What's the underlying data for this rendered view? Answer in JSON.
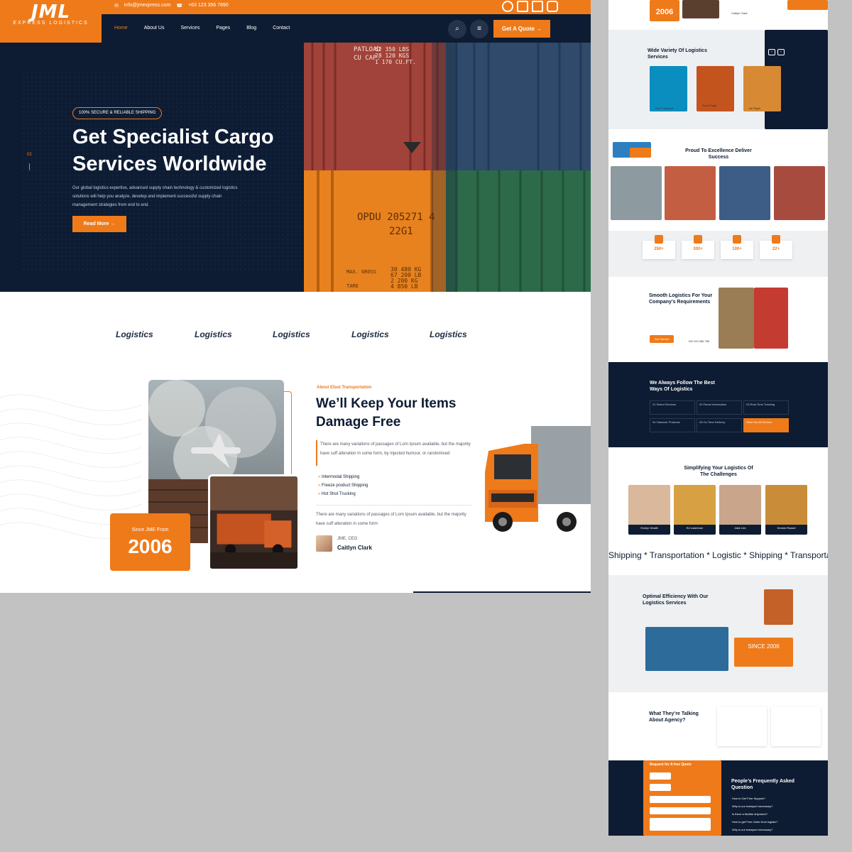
{
  "brand": {
    "logo_mark": "JML",
    "logo_sub": "EXPRESS LOGISTICS"
  },
  "topbar": {
    "email": "info@jmexpress.com",
    "phone": "+63 123 356 7890"
  },
  "nav": {
    "items": [
      "Home",
      "About Us",
      "Services",
      "Pages",
      "Blog",
      "Contact"
    ],
    "search_icon": "⌕",
    "menu_icon": "≡",
    "cta": "Get A Quote →"
  },
  "hero": {
    "badge": "100% SECURE & RELIABLE SHIPPING",
    "title": "Get Specialist Cargo Services Worldwide",
    "text": "Our global logistics expertise, advanced supply chain technology & customized logistics solutions will help you analyze, develop and implement successful supply chain management strategies from end to end.",
    "button": "Read More →",
    "slide": "02",
    "container_codes": [
      "PATLOAD",
      "CU CAP.",
      "62 350 LBS",
      "28 120 KGS",
      "1 170 CU.FT.",
      "OPDU 205271 4",
      "22G1",
      "MAX. GROSS",
      "TARE",
      "30 480 KG",
      "67 200 LB",
      "2 200 KG",
      "4 850 LB"
    ]
  },
  "brands": [
    "Logistics",
    "Logistics",
    "Logistics",
    "Logistics",
    "Logistics"
  ],
  "about": {
    "eyebrow": "About Efast Transportation",
    "title": "We’ll Keep Your Items Damage Free",
    "quote": "There are many variations of passages of Lorn Ipsum available, but the majority have suff alteration in some form, by injected humour, or randomised",
    "list": [
      "Intermodal Shipping",
      "Freeze product Shipping",
      "Hot Shot Trucking"
    ],
    "text2": "There are many variations of passages of Lorn Ipsum available, but the majority have suff alteration in some form",
    "ceo_role": "JME, CEO",
    "ceo_name": "Caitlyn Clark",
    "since_label": "Since JME From",
    "since_year": "2006"
  },
  "side": {
    "top_year": "2006",
    "top_name": "Caitlyn Clark",
    "variety_title": "Wide Variety Of Logistics Services",
    "services": [
      "Sea Transport",
      "Road Flight",
      "Air Flight"
    ],
    "proud_title": "Proud To Excellence Deliver Success",
    "stats": [
      "250+",
      "300+",
      "100+",
      "22+"
    ],
    "smooth_title": "Smooth Logistics For Your Company’s Requirements",
    "get_started": "Get Started",
    "phone": "+63 123 456 789",
    "ways_title": "We Always Follow The Best Ways Of Logistics",
    "steps": [
      "01 Select Services",
      "02 Parcel Information",
      "03 Real-Time Tracking",
      "04 Takeover Products",
      "05 On Time Delivery"
    ],
    "view_all": "View Our All Service",
    "team_title": "Simplifying Your Logistics Of The Challenges",
    "team": [
      "Evelyn Hewitt",
      "Ed Lawrence",
      "Jake Lee",
      "Dennis Russel"
    ],
    "marquee": "Shipping * Transportation * Logistic * Shipping * Transportation",
    "optimal_title": "Optimal Efficiency With Our Logistics Services",
    "since_big": "SINCE 2006",
    "testimonial_title": "What They’re Talking About Agency?",
    "quote_form_title": "Request for A free Quote",
    "faq_title": "People’s Frequently Asked Question",
    "faq": [
      "How to Get Free Support?",
      "Why is our transport necessary?",
      "Is there a flexible shipment?",
      "How to get Free Order from logistic?",
      "Why is our transport necessary?"
    ]
  },
  "colors": {
    "accent": "#ef7a1a",
    "navy": "#0d1c33"
  }
}
